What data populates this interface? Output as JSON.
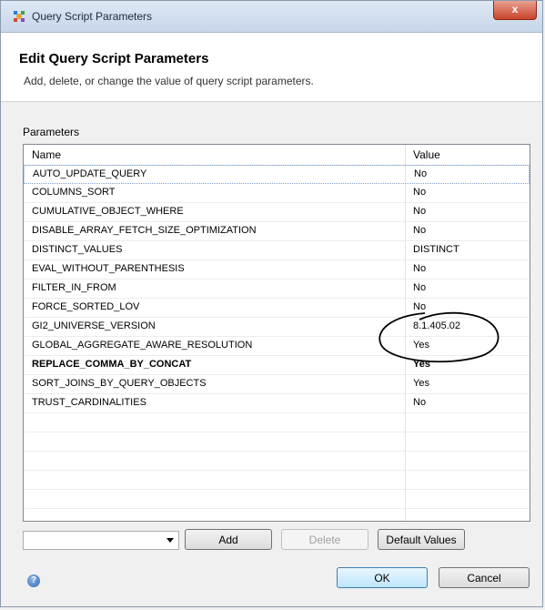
{
  "window": {
    "title": "Query Script Parameters",
    "close_label": "x"
  },
  "header": {
    "title": "Edit Query Script Parameters",
    "description": "Add, delete, or change the value of query script parameters."
  },
  "params": {
    "label": "Parameters",
    "columns": [
      "Name",
      "Value"
    ],
    "rows": [
      {
        "name": "AUTO_UPDATE_QUERY",
        "value": "No"
      },
      {
        "name": "COLUMNS_SORT",
        "value": "No"
      },
      {
        "name": "CUMULATIVE_OBJECT_WHERE",
        "value": "No"
      },
      {
        "name": "DISABLE_ARRAY_FETCH_SIZE_OPTIMIZATION",
        "value": "No"
      },
      {
        "name": "DISTINCT_VALUES",
        "value": "DISTINCT"
      },
      {
        "name": "EVAL_WITHOUT_PARENTHESIS",
        "value": "No"
      },
      {
        "name": "FILTER_IN_FROM",
        "value": "No"
      },
      {
        "name": "FORCE_SORTED_LOV",
        "value": "No"
      },
      {
        "name": "GI2_UNIVERSE_VERSION",
        "value": "8.1.405.02"
      },
      {
        "name": "GLOBAL_AGGREGATE_AWARE_RESOLUTION",
        "value": "Yes"
      },
      {
        "name": "REPLACE_COMMA_BY_CONCAT",
        "value": "Yes"
      },
      {
        "name": "SORT_JOINS_BY_QUERY_OBJECTS",
        "value": "Yes"
      },
      {
        "name": "TRUST_CARDINALITIES",
        "value": "No"
      }
    ]
  },
  "toolbar": {
    "combo_value": "",
    "add_label": "Add",
    "delete_label": "Delete",
    "defaults_label": "Default Values"
  },
  "footer": {
    "help_icon": "help-icon",
    "ok_label": "OK",
    "cancel_label": "Cancel"
  },
  "colors": {
    "selection_border": "#7da2ce",
    "annotation_ink": "#000000"
  }
}
